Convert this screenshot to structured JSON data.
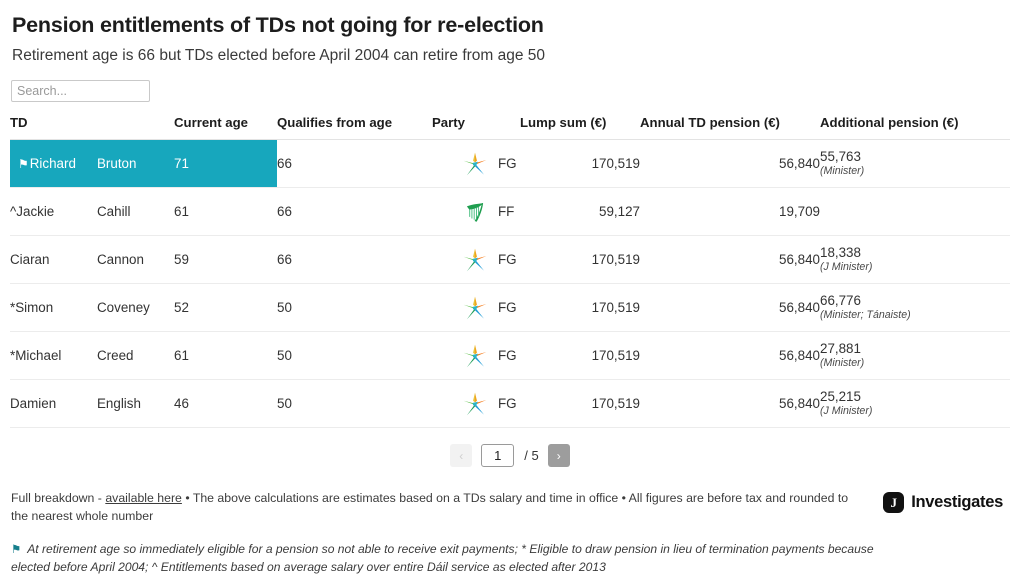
{
  "header": {
    "title": "Pension entitlements of TDs not going for re-election",
    "subtitle": "Retirement age is 66 but TDs elected before April 2004 can retire from age 50"
  },
  "search": {
    "placeholder": "Search...",
    "value": ""
  },
  "table": {
    "columns": [
      "TD",
      "Current age",
      "Qualifies from age",
      "Party",
      "Lump sum (€)",
      "Annual TD pension (€)",
      "Additional pension (€)"
    ],
    "rows": [
      {
        "marker": "⚑",
        "first_name": "Richard",
        "last_name": "Bruton",
        "current_age": "71",
        "qualifies_from_age": "66",
        "party": "FG",
        "party_logo": "fine-gael-star-icon",
        "lump_sum": "170,519",
        "annual_pension": "56,840",
        "additional_pension": "55,763",
        "additional_note": "(Minister)",
        "highlighted": true
      },
      {
        "marker": "^",
        "first_name": "Jackie",
        "last_name": "Cahill",
        "current_age": "61",
        "qualifies_from_age": "66",
        "party": "FF",
        "party_logo": "fianna-fail-harp-icon",
        "lump_sum": "59,127",
        "annual_pension": "19,709",
        "additional_pension": "",
        "additional_note": "",
        "highlighted": false
      },
      {
        "marker": "",
        "first_name": "Ciaran",
        "last_name": "Cannon",
        "current_age": "59",
        "qualifies_from_age": "66",
        "party": "FG",
        "party_logo": "fine-gael-star-icon",
        "lump_sum": "170,519",
        "annual_pension": "56,840",
        "additional_pension": "18,338",
        "additional_note": "(J Minister)",
        "highlighted": false
      },
      {
        "marker": "*",
        "first_name": "Simon",
        "last_name": "Coveney",
        "current_age": "52",
        "qualifies_from_age": "50",
        "party": "FG",
        "party_logo": "fine-gael-star-icon",
        "lump_sum": "170,519",
        "annual_pension": "56,840",
        "additional_pension": "66,776",
        "additional_note": "(Minister; Tánaiste)",
        "highlighted": false
      },
      {
        "marker": "*",
        "first_name": "Michael",
        "last_name": "Creed",
        "current_age": "61",
        "qualifies_from_age": "50",
        "party": "FG",
        "party_logo": "fine-gael-star-icon",
        "lump_sum": "170,519",
        "annual_pension": "56,840",
        "additional_pension": "27,881",
        "additional_note": "(Minister)",
        "highlighted": false
      },
      {
        "marker": "",
        "first_name": "Damien",
        "last_name": "English",
        "current_age": "46",
        "qualifies_from_age": "50",
        "party": "FG",
        "party_logo": "fine-gael-star-icon",
        "lump_sum": "170,519",
        "annual_pension": "56,840",
        "additional_pension": "25,215",
        "additional_note": "(J Minister)",
        "highlighted": false
      }
    ]
  },
  "pagination": {
    "prev_label": "‹",
    "next_label": "›",
    "current_page": "1",
    "total_label": "/ 5"
  },
  "footer": {
    "prefix": "Full breakdown - ",
    "link_text": "available here",
    "suffix": " • The above calculations are estimates based on a TDs salary and time in office • All figures are before tax and rounded to the nearest whole number",
    "brand_initial": "J",
    "brand_name": "Investigates"
  },
  "footnote": {
    "flag": "⚑",
    "text": " At retirement age so immediately eligible for a pension so not able to receive exit payments; * Eligible to draw pension in lieu of termination payments because elected before April 2004; ^ Entitlements based on average salary over entire Dáil service as elected after 2013"
  },
  "colors": {
    "highlight": "#17a7bd",
    "footnote_flag": "#177f8c",
    "pager_active": "#9d9d9d"
  }
}
